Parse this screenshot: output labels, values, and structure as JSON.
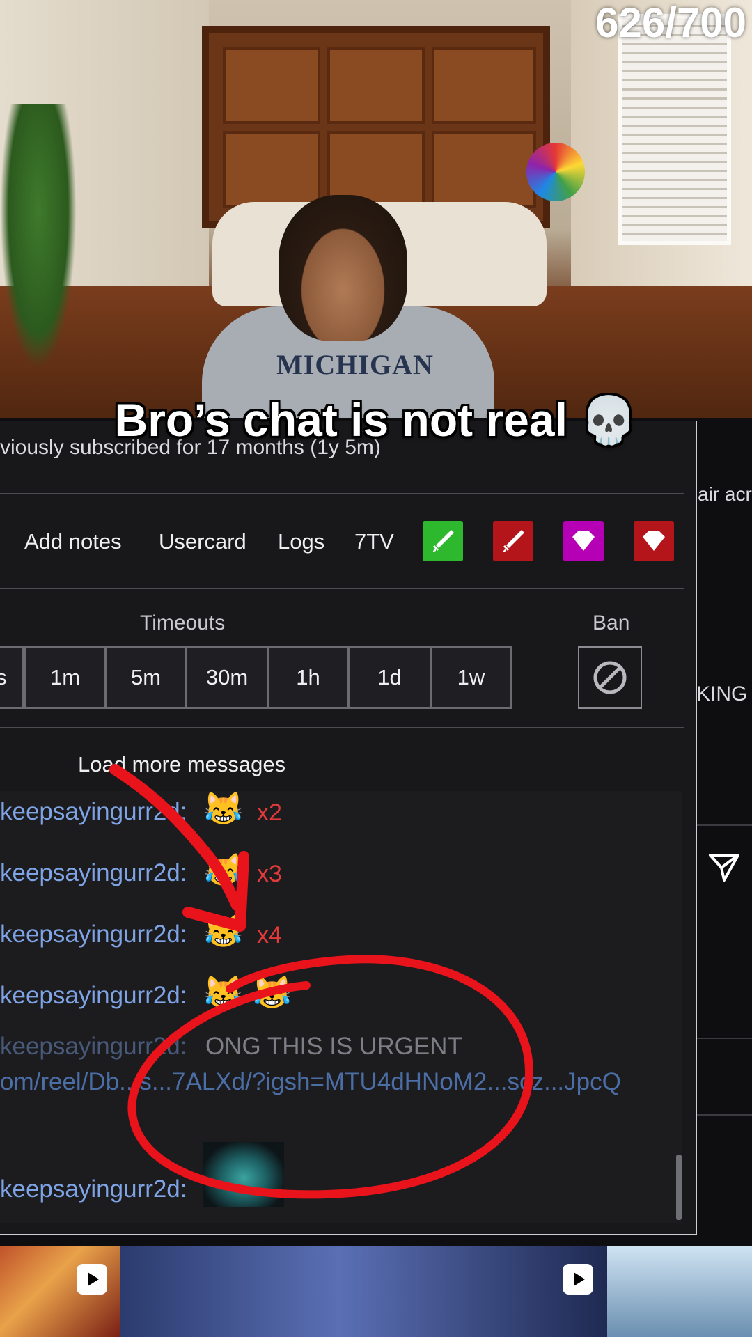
{
  "overlay": {
    "counter": "626/700",
    "caption": "Bro’s chat is not real 💀"
  },
  "usercard": {
    "previous_sub": "viously subscribed for 17 months (1y 5m)",
    "links": [
      "Add notes",
      "Usercard",
      "Logs",
      "7TV"
    ],
    "mod_buttons": [
      {
        "icon": "sword-icon",
        "color": "#2eb82e"
      },
      {
        "icon": "sword-icon",
        "color": "#b3151a"
      },
      {
        "icon": "diamond-icon",
        "color": "#b600b6"
      },
      {
        "icon": "diamond-icon",
        "color": "#b3151a"
      }
    ],
    "timeouts_label": "Timeouts",
    "ban_label": "Ban",
    "timeouts": [
      "s",
      "1m",
      "5m",
      "30m",
      "1h",
      "1d",
      "1w"
    ],
    "load_more": "Load more messages"
  },
  "chat": {
    "username": "keepsayingurr2d:",
    "messages": [
      {
        "emoji": "😹",
        "multiplier": "x2"
      },
      {
        "emoji": "😹",
        "multiplier": "x3"
      },
      {
        "emoji": "😹",
        "multiplier": "x4"
      },
      {
        "emoji": "😹 😹",
        "multiplier": ""
      }
    ],
    "urgent_text": "ONG THIS IS URGENT",
    "urgent_link": "om/reel/Db...s...7ALXd/?igsh=MTU4dHNoM2...scz...JpcQ"
  },
  "side": {
    "text1": "air acr",
    "text2": "KING C"
  },
  "colors": {
    "username": "#7fa4e6",
    "annotation": "#e8131b",
    "multiplier": "#e23a3a"
  }
}
